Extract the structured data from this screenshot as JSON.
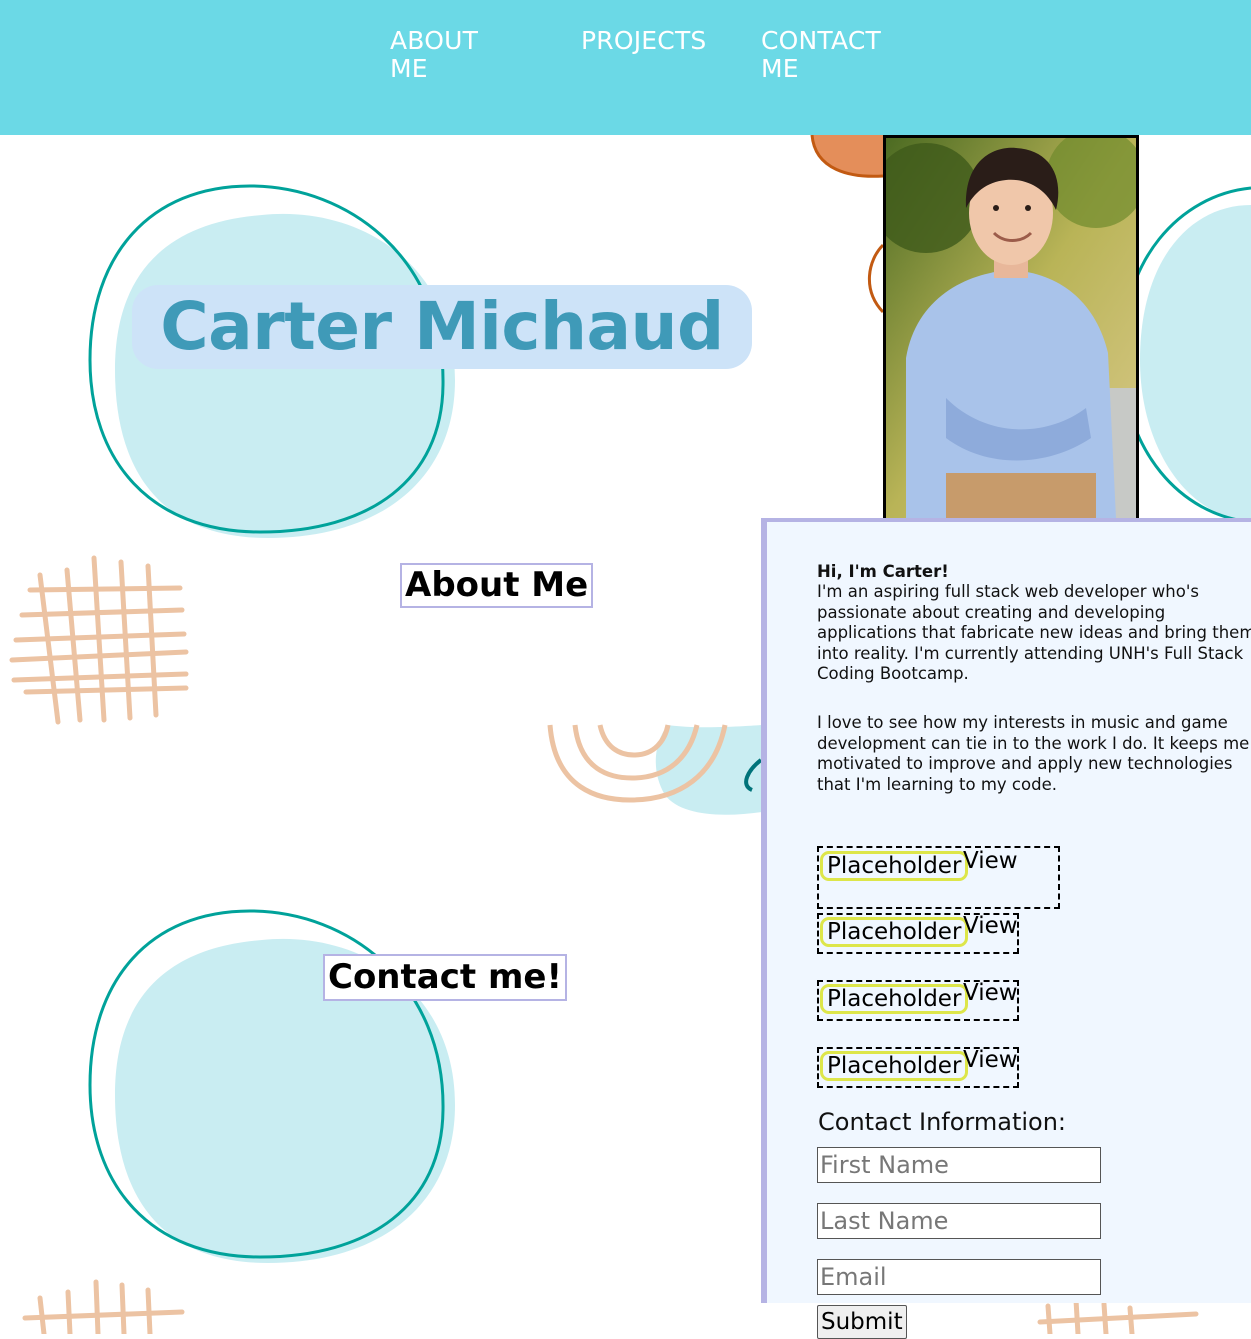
{
  "nav": {
    "items": [
      {
        "label": "ABOUT ME"
      },
      {
        "label": "PROJECTS"
      },
      {
        "label": "CONTACT ME"
      }
    ]
  },
  "hero": {
    "name": "Carter Michaud"
  },
  "about": {
    "title": "About Me",
    "greeting": "Hi, I'm Carter!",
    "paragraph1": "I'm an aspiring full stack web developer who's passionate about creating and developing applications that fabricate new ideas and bring them into reality. I'm currently attending UNH's Full Stack Coding Bootcamp.",
    "paragraph2": "I love to see how my interests in music and game development can tie in to the work I do. It keeps me motivated to improve and apply new technologies that I'm learning to my code."
  },
  "projects": {
    "items": [
      {
        "name": "Placeholder",
        "link": "View"
      },
      {
        "name": "Placeholder",
        "link": "View"
      },
      {
        "name": "Placeholder",
        "link": "View"
      },
      {
        "name": "Placeholder",
        "link": "View"
      }
    ]
  },
  "contact": {
    "title": "Contact me!",
    "form_label": "Contact Information:",
    "first_name_placeholder": "First Name",
    "last_name_placeholder": "Last Name",
    "email_placeholder": "Email",
    "submit_label": "Submit"
  },
  "colors": {
    "nav_bg": "#6bd9e6",
    "name_text": "#3f9ab8",
    "name_bg": "#cde3f8",
    "blob_fill": "#c9edf2",
    "blob_stroke": "#00a29a",
    "grid_stroke": "#ecc3a3",
    "panel_bg": "#f0f7ff",
    "panel_border": "#b5b3e4",
    "project_highlight": "#dde64a"
  }
}
